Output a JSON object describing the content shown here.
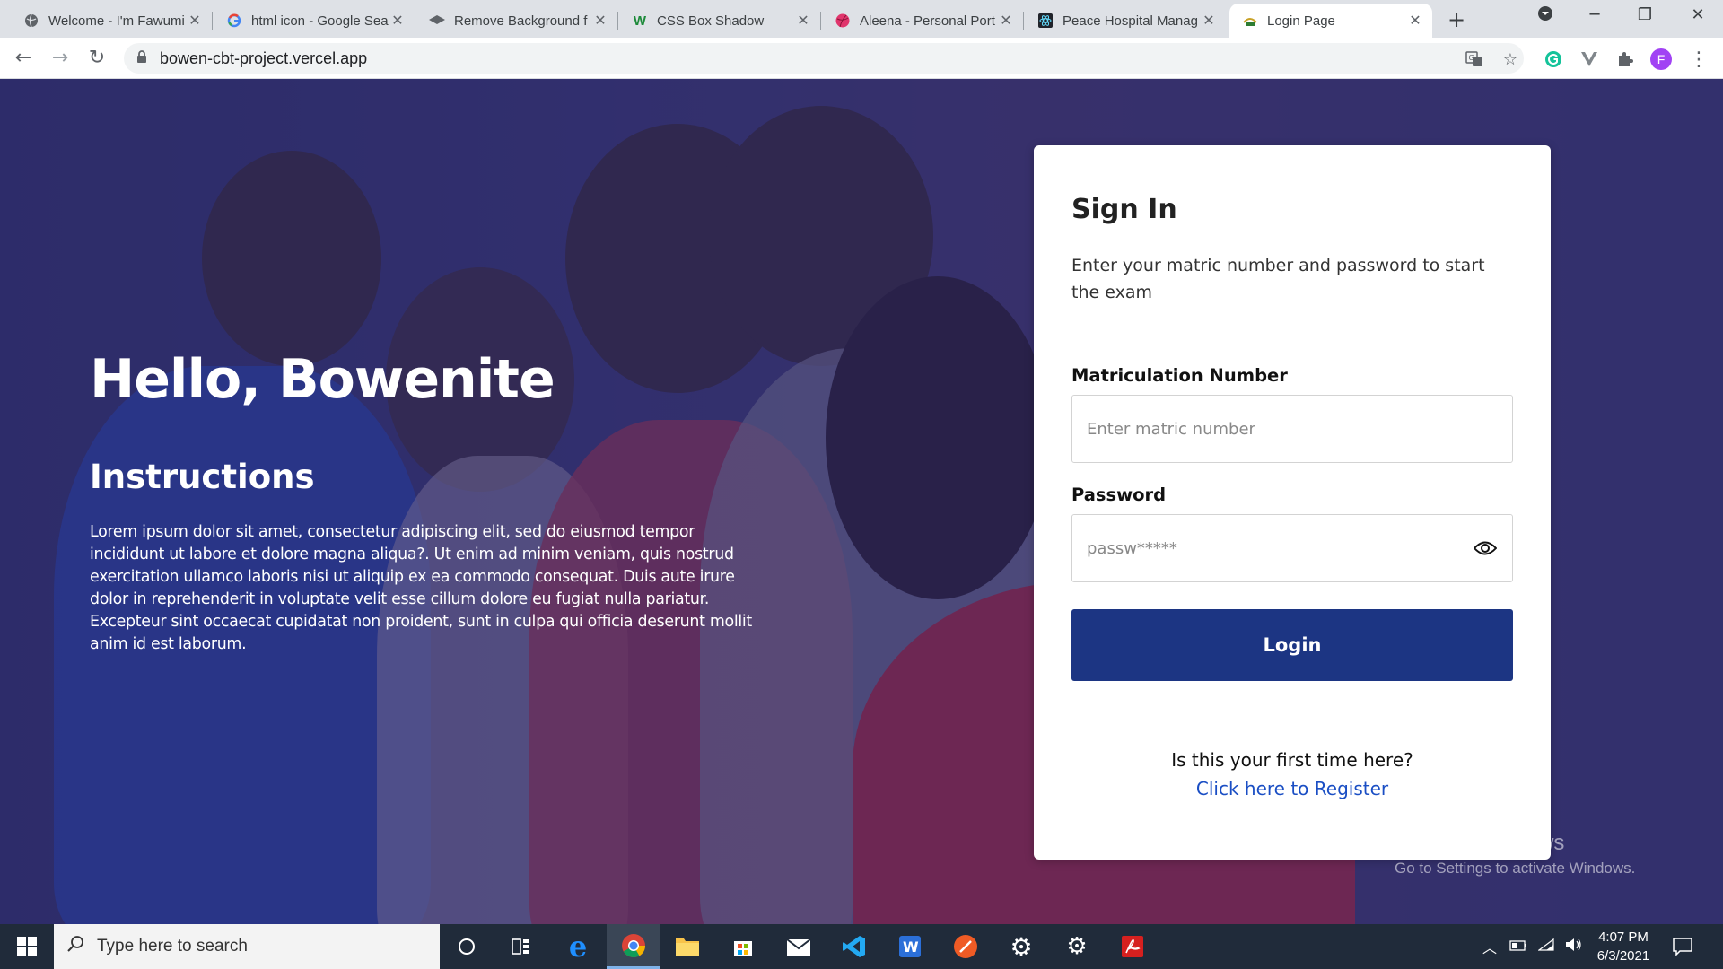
{
  "browser": {
    "tabs": [
      {
        "title": "Welcome - I'm Fawumi",
        "icon": "globe-icon"
      },
      {
        "title": "html icon - Google Search",
        "icon": "google-icon"
      },
      {
        "title": "Remove Background f",
        "icon": "removebg-icon"
      },
      {
        "title": "CSS Box Shadow",
        "icon": "w-icon"
      },
      {
        "title": "Aleena - Personal Port",
        "icon": "dribbble-icon"
      },
      {
        "title": "Peace Hospital Manag",
        "icon": "react-icon"
      },
      {
        "title": "Login Page",
        "icon": "bowen-logo-icon"
      }
    ],
    "active_tab": 6,
    "url": "bowen-cbt-project.vercel.app",
    "profile_initial": "F"
  },
  "hero": {
    "greeting": "Hello, Bowenite",
    "instructions_title": "Instructions",
    "instructions_text": "Lorem ipsum dolor sit amet, consectetur adipiscing elit, sed do eiusmod tempor incididunt ut labore et dolore magna aliqua?. Ut enim ad minim veniam, quis nostrud exercitation ullamco laboris nisi ut aliquip ex ea commodo consequat. Duis aute irure dolor in reprehenderit in voluptate velit esse cillum dolore eu fugiat nulla pariatur. Excepteur sint occaecat cupidatat non proident, sunt in culpa qui officia deserunt mollit anim id est laborum."
  },
  "signin": {
    "title": "Sign In",
    "subtitle": "Enter your matric number and password to start the exam",
    "matric_label": "Matriculation Number",
    "matric_placeholder": "Enter matric number",
    "password_label": "Password",
    "password_placeholder": "passw*****",
    "login_label": "Login",
    "first_time": "Is this your first time here?",
    "register_link": "Click here to Register"
  },
  "watermark": {
    "line1": "Activate Windows",
    "line2": "Go to Settings to activate Windows."
  },
  "taskbar": {
    "search_placeholder": "Type here to search",
    "time": "4:07 PM",
    "date": "6/3/2021"
  },
  "colors": {
    "accent": "#1c3583",
    "overlay": "#2d2b6e",
    "link": "#1a4ec4"
  }
}
